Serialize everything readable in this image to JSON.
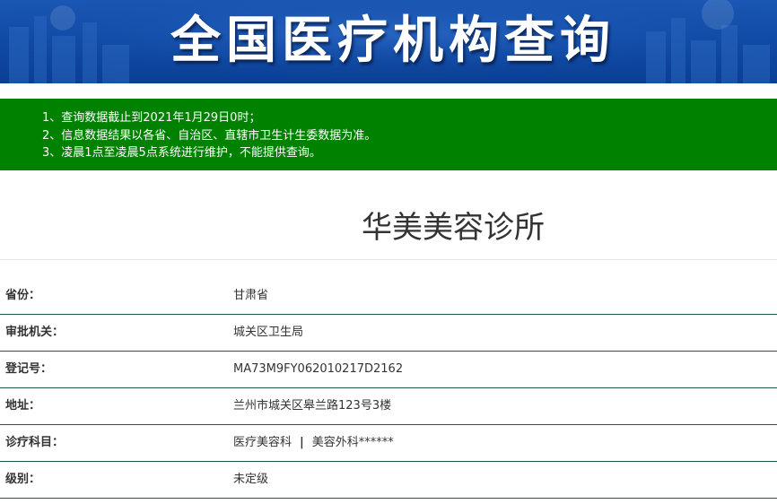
{
  "banner": {
    "title": "全国医疗机构查询"
  },
  "notice": {
    "lines": [
      "1、查询数据截止到2021年1月29日0时；",
      "2、信息数据结果以各省、自治区、直辖市卫生计生委数据为准。",
      "3、凌晨1点至凌晨5点系统进行维护，不能提供查询。"
    ]
  },
  "clinic": {
    "name": "华美美容诊所"
  },
  "info": {
    "rows": [
      {
        "label": "省份：",
        "value": "甘肃省"
      },
      {
        "label": "审批机关：",
        "value": "城关区卫生局"
      },
      {
        "label": "登记号：",
        "value": "MA73M9FY062010217D2162"
      },
      {
        "label": "地址：",
        "value": "兰州市城关区皋兰路123号3楼"
      },
      {
        "label": "诊疗科目：",
        "values": [
          "医疗美容科",
          "美容外科******"
        ],
        "separator": "|"
      },
      {
        "label": "级别：",
        "value": "未定级"
      }
    ]
  },
  "colors": {
    "banner": "#0f4aa6",
    "notice": "#008200",
    "row_border": "#1c5a47",
    "text": "#333333"
  }
}
